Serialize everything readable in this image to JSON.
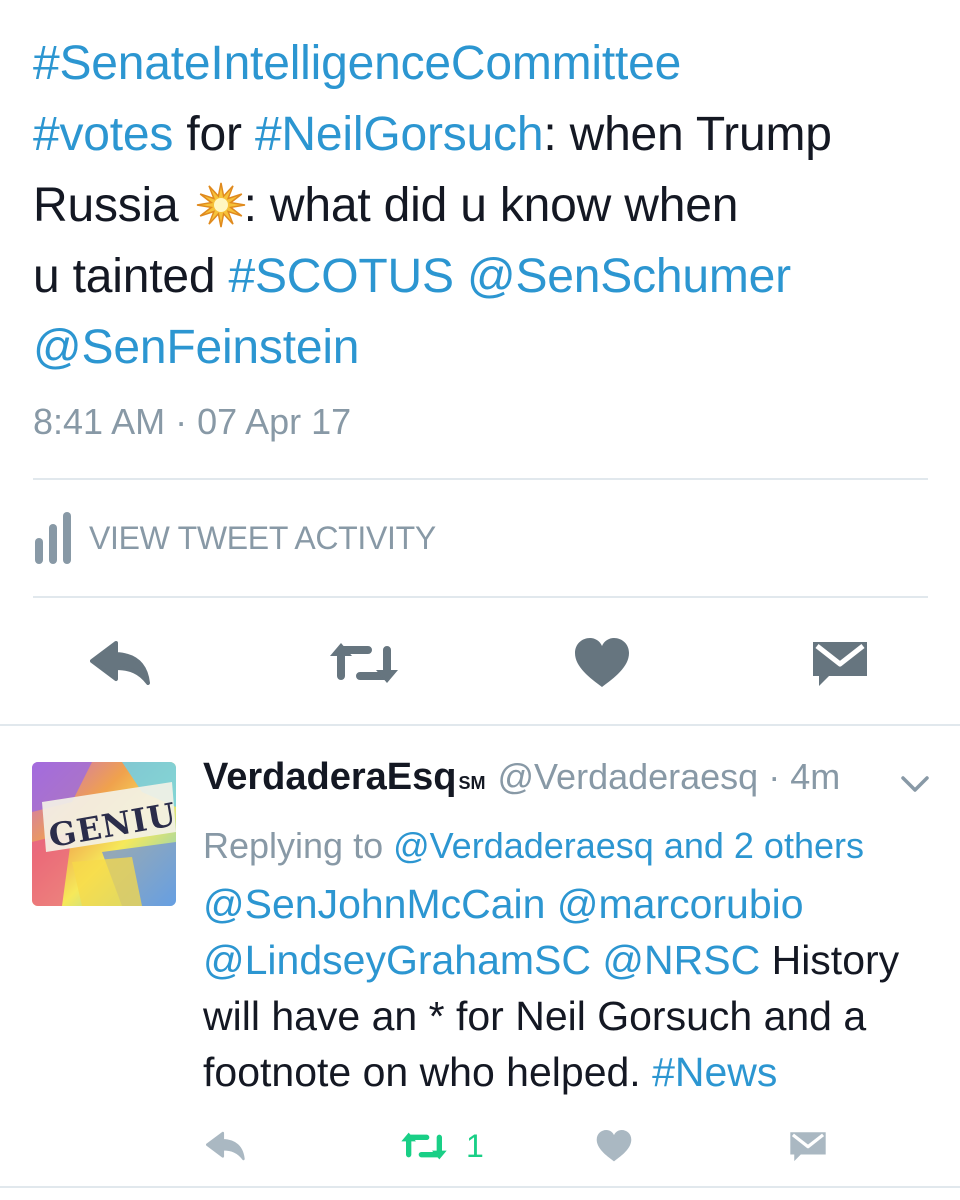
{
  "main_tweet": {
    "lines": [
      {
        "parts": [
          {
            "text": "#SenateIntelligenceCommittee",
            "link": true
          }
        ]
      },
      {
        "parts": [
          {
            "text": "#votes",
            "link": true
          },
          {
            "text": " for ",
            "link": false
          },
          {
            "text": "#NeilGorsuch",
            "link": true
          },
          {
            "text": ": when Trump",
            "link": false
          }
        ]
      },
      {
        "parts": [
          {
            "text": "Russia ",
            "link": false
          },
          {
            "emoji": "collision"
          },
          {
            "text": ": what did u know when",
            "link": false
          }
        ]
      },
      {
        "parts": [
          {
            "text": "u tainted ",
            "link": false
          },
          {
            "text": "#SCOTUS",
            "link": true
          },
          {
            "text": " ",
            "link": false
          },
          {
            "text": "@SenSchumer",
            "link": true
          }
        ]
      },
      {
        "parts": [
          {
            "text": "@SenFeinstein",
            "link": true
          }
        ]
      }
    ],
    "timestamp": "8:41 AM · 07 Apr 17",
    "activity_label": "VIEW TWEET ACTIVITY",
    "activity_icon": "bar-chart-icon",
    "actions": [
      {
        "name": "reply",
        "icon": "reply-icon"
      },
      {
        "name": "retweet",
        "icon": "retweet-icon"
      },
      {
        "name": "like",
        "icon": "heart-icon"
      },
      {
        "name": "direct-message",
        "icon": "envelope-icon"
      }
    ]
  },
  "reply": {
    "display_name": "VerdaderaEsq",
    "service_mark": "SM",
    "handle_time": "@Verdaderaesq · 4m",
    "avatar_word": "GENIUS",
    "replying_prefix": "Replying to ",
    "replying_targets": "@Verdaderaesq and 2 others",
    "lines": [
      {
        "parts": [
          {
            "text": "@SenJohnMcCain",
            "link": true
          },
          {
            "text": " ",
            "link": false
          },
          {
            "text": "@marcorubio",
            "link": true
          }
        ]
      },
      {
        "parts": [
          {
            "text": "@LindseyGrahamSC",
            "link": true
          },
          {
            "text": " ",
            "link": false
          },
          {
            "text": "@NRSC",
            "link": true
          },
          {
            "text": " History",
            "link": false
          }
        ]
      },
      {
        "parts": [
          {
            "text": "will have an * for Neil Gorsuch and a",
            "link": false
          }
        ]
      },
      {
        "parts": [
          {
            "text": "footnote on who helped. ",
            "link": false
          },
          {
            "text": "#News",
            "link": true
          }
        ]
      }
    ],
    "retweet_count": "1"
  },
  "colors": {
    "link": "#2c96d1",
    "text": "#141823",
    "muted": "#8899a6",
    "icon": "#66757f",
    "retweeted": "#19cf86",
    "divider": "#e1e8ed"
  }
}
